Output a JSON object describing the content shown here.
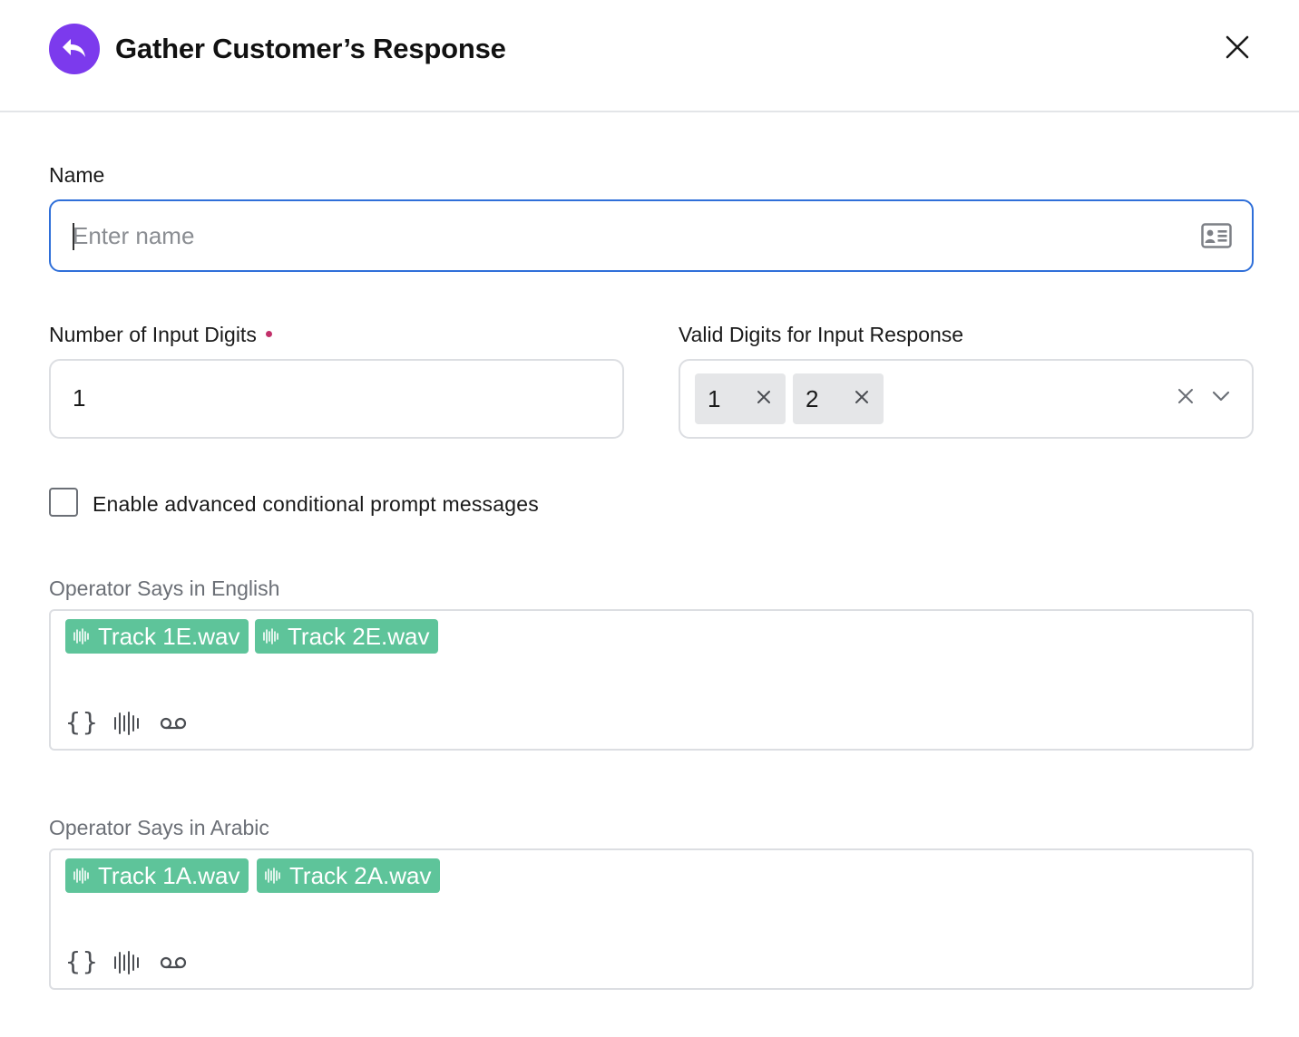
{
  "header": {
    "title": "Gather Customer’s Response"
  },
  "name_field": {
    "label": "Name",
    "placeholder": "Enter name",
    "value": ""
  },
  "digits_field": {
    "label": "Number of Input Digits",
    "value": "1"
  },
  "valid_digits_field": {
    "label": "Valid Digits for Input Response",
    "selected": [
      "1",
      "2"
    ]
  },
  "advanced_checkbox": {
    "label": "Enable advanced conditional prompt messages",
    "checked": false
  },
  "english_prompt": {
    "label": "Operator Says in English",
    "tracks": [
      "Track 1E.wav",
      "Track 2E.wav"
    ],
    "tools": [
      "variable-braces-icon",
      "audio-wave-icon",
      "voicemail-icon"
    ]
  },
  "arabic_prompt": {
    "label": "Operator Says in Arabic",
    "tracks": [
      "Track 1A.wav",
      "Track 2A.wav"
    ],
    "tools": [
      "variable-braces-icon",
      "audio-wave-icon",
      "voicemail-icon"
    ]
  },
  "colors": {
    "accent_purple": "#7c3aed",
    "focus_blue": "#2f6fd9",
    "track_green": "#5ec49a",
    "required_dot": "#c2306a"
  }
}
